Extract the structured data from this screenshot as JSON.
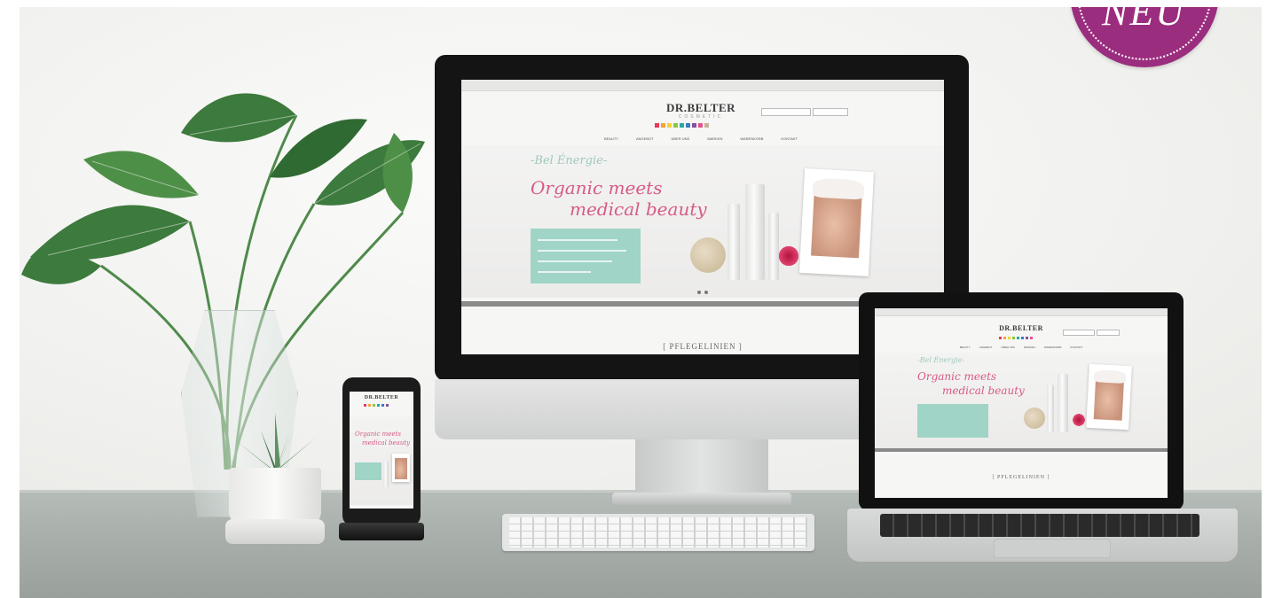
{
  "badge": {
    "text": "NEU",
    "color": "#9b2d7f"
  },
  "brand": {
    "name": "DR.BELTER",
    "sub": "COSMETIC"
  },
  "swatches": [
    "#e63a5a",
    "#f4a23a",
    "#f2d43a",
    "#8cc63f",
    "#2aa7a0",
    "#3a7dc2",
    "#8a4ea1",
    "#e4548c",
    "#c7b299"
  ],
  "nav": [
    "BEAUTY",
    "ANGEBOT",
    "ÜBER UNS",
    "MARKEN",
    "WARENKORB",
    "KONTAKT"
  ],
  "hero": {
    "tagline": "-Bel Énergie-",
    "script_line1": "Organic meets",
    "script_line2": "medical beauty"
  },
  "section": {
    "title": "[ PFLEGELINIEN ]"
  },
  "colors": {
    "mint": "#9fd4c6",
    "script": "#d85a86"
  }
}
